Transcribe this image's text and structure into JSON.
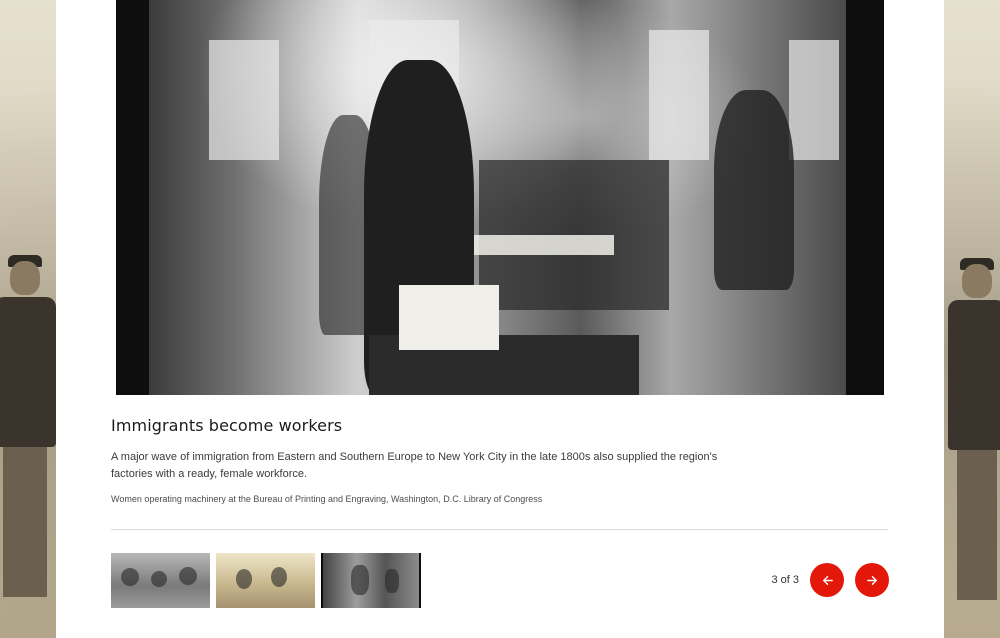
{
  "slide": {
    "title": "Immigrants become workers",
    "description": "A major wave of immigration from Eastern and Southern Europe to New York City in the late 1800s also supplied the region's factories with a ready, female workforce.",
    "credit": "Women operating machinery at the Bureau of Printing and Engraving, Washington, D.C. Library of Congress"
  },
  "pagination": {
    "counter": "3 of 3",
    "prev_icon": "arrow-left-icon",
    "next_icon": "arrow-right-icon"
  },
  "colors": {
    "accent": "#e3170a",
    "card": "#ffffff"
  }
}
